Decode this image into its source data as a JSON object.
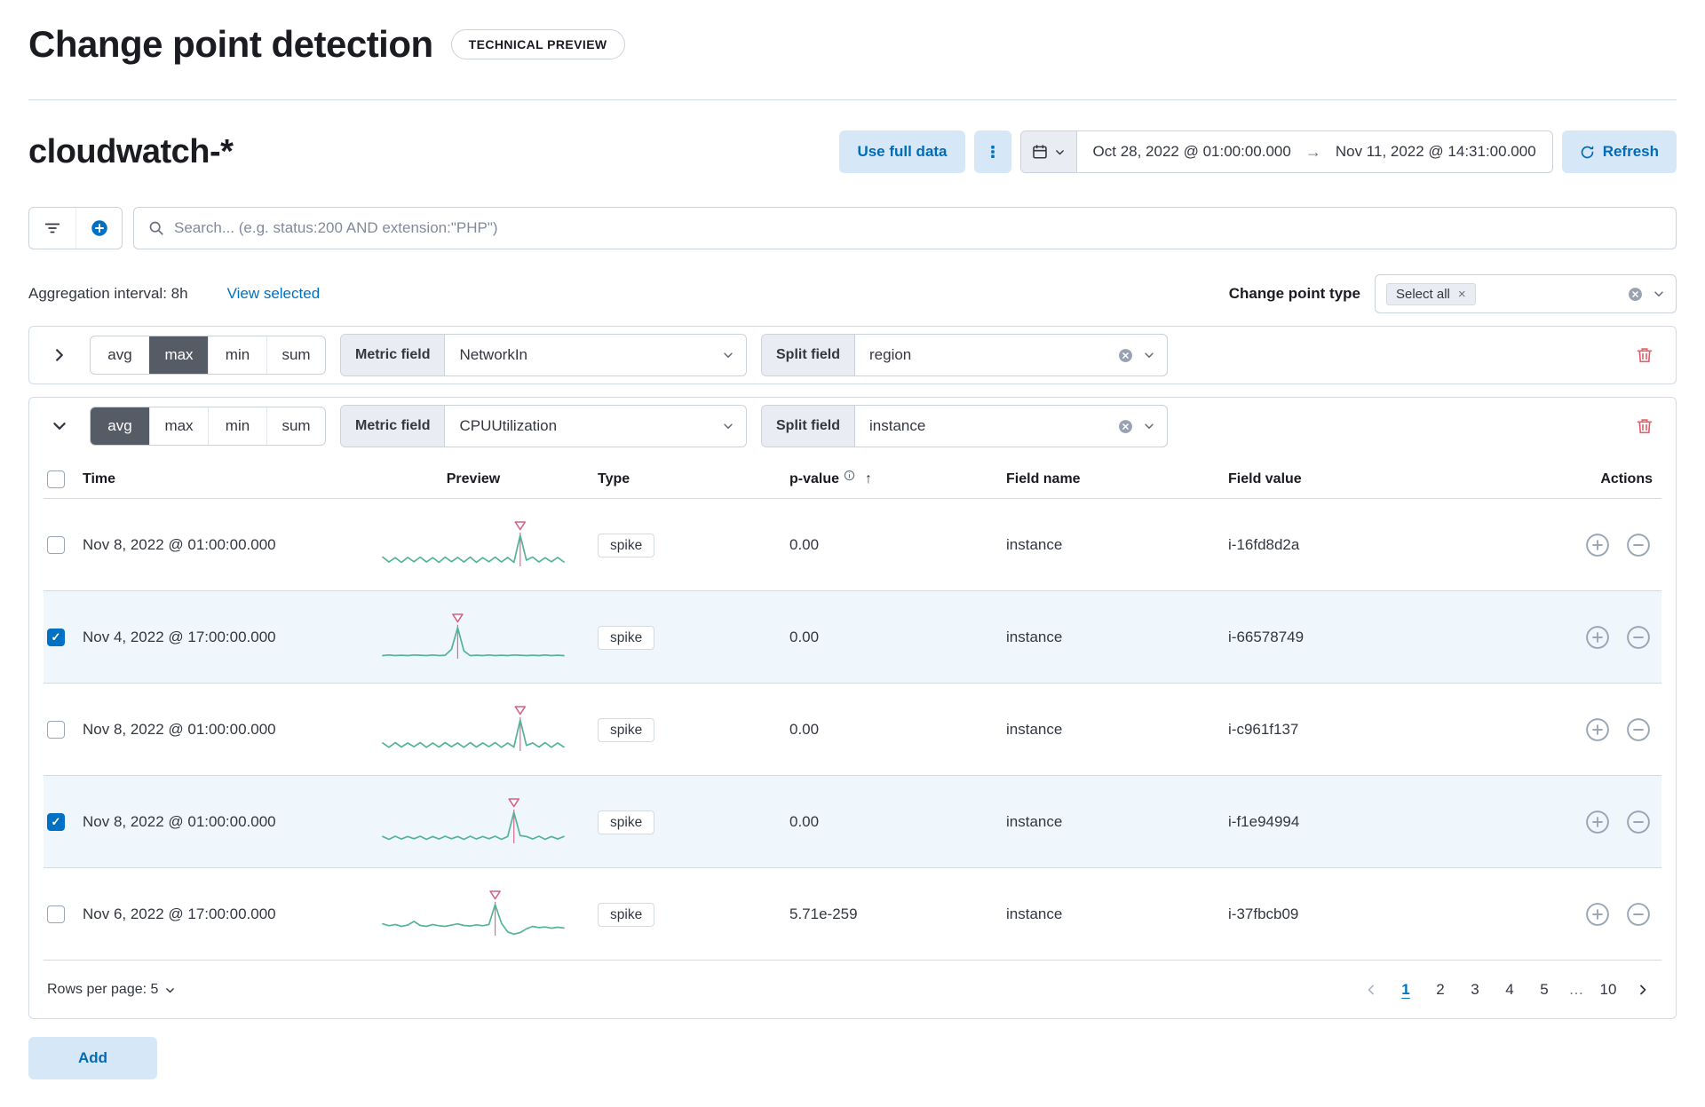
{
  "page": {
    "title": "Change point detection",
    "badge": "TECHNICAL PREVIEW"
  },
  "toolbar": {
    "data_view": "cloudwatch-*",
    "use_full_data_label": "Use full data",
    "date_start": "Oct 28, 2022 @ 01:00:00.000",
    "date_end": "Nov 11, 2022 @ 14:31:00.000",
    "refresh_label": "Refresh"
  },
  "search": {
    "placeholder": "Search... (e.g. status:200 AND extension:\"PHP\")"
  },
  "meta": {
    "aggregation_interval": "Aggregation interval: 8h",
    "view_selected_label": "View selected",
    "change_point_type_label": "Change point type",
    "change_point_type_selected": "Select all"
  },
  "configs": [
    {
      "expanded": false,
      "functions": [
        "avg",
        "max",
        "min",
        "sum"
      ],
      "selected_function": "max",
      "metric_field_label": "Metric field",
      "metric_field_value": "NetworkIn",
      "split_field_label": "Split field",
      "split_field_value": "region"
    },
    {
      "expanded": true,
      "functions": [
        "avg",
        "max",
        "min",
        "sum"
      ],
      "selected_function": "avg",
      "metric_field_label": "Metric field",
      "metric_field_value": "CPUUtilization",
      "split_field_label": "Split field",
      "split_field_value": "instance"
    }
  ],
  "table": {
    "columns": {
      "time": "Time",
      "preview": "Preview",
      "type": "Type",
      "p_value": "p-value",
      "field_name": "Field name",
      "field_value": "Field value",
      "actions": "Actions"
    },
    "rows": [
      {
        "checked": false,
        "time": "Nov 8, 2022 @ 01:00:00.000",
        "type": "spike",
        "p_value": "0.00",
        "field_name": "instance",
        "field_value": "i-16fd8d2a"
      },
      {
        "checked": true,
        "time": "Nov 4, 2022 @ 17:00:00.000",
        "type": "spike",
        "p_value": "0.00",
        "field_name": "instance",
        "field_value": "i-66578749"
      },
      {
        "checked": false,
        "time": "Nov 8, 2022 @ 01:00:00.000",
        "type": "spike",
        "p_value": "0.00",
        "field_name": "instance",
        "field_value": "i-c961f137"
      },
      {
        "checked": true,
        "time": "Nov 8, 2022 @ 01:00:00.000",
        "type": "spike",
        "p_value": "0.00",
        "field_name": "instance",
        "field_value": "i-f1e94994"
      },
      {
        "checked": false,
        "time": "Nov 6, 2022 @ 17:00:00.000",
        "type": "spike",
        "p_value": "5.71e-259",
        "field_name": "instance",
        "field_value": "i-37fbcb09"
      }
    ]
  },
  "pagination": {
    "rows_per_page_label": "Rows per page: 5",
    "pages": [
      "1",
      "2",
      "3",
      "4",
      "5",
      "…",
      "10"
    ],
    "active_page": "1"
  },
  "footer": {
    "add_label": "Add"
  },
  "colors": {
    "primary": "#0071c2",
    "line": "#54b399",
    "spike": "#d36086",
    "danger": "#e0616d"
  },
  "chart_data": {
    "type": "line",
    "description": "Row preview sparklines; green line = metric over time, pink vertical line + open triangle marker = detected change point (spike)",
    "sparklines": [
      {
        "field_value": "i-16fd8d2a",
        "spike_index": 22,
        "values": [
          0.3,
          0.14,
          0.28,
          0.13,
          0.29,
          0.15,
          0.3,
          0.14,
          0.28,
          0.13,
          0.3,
          0.15,
          0.29,
          0.14,
          0.3,
          0.13,
          0.28,
          0.15,
          0.3,
          0.14,
          0.29,
          0.13,
          1.0,
          0.2,
          0.3,
          0.14,
          0.28,
          0.15,
          0.29,
          0.14
        ]
      },
      {
        "field_value": "i-66578749",
        "spike_index": 12,
        "values": [
          0.1,
          0.12,
          0.1,
          0.11,
          0.1,
          0.12,
          0.11,
          0.1,
          0.12,
          0.1,
          0.11,
          0.3,
          1.0,
          0.25,
          0.1,
          0.11,
          0.1,
          0.12,
          0.1,
          0.11,
          0.1,
          0.12,
          0.11,
          0.1,
          0.11,
          0.1,
          0.12,
          0.1,
          0.11,
          0.1
        ]
      },
      {
        "field_value": "i-c961f137",
        "spike_index": 22,
        "values": [
          0.26,
          0.12,
          0.27,
          0.13,
          0.26,
          0.14,
          0.27,
          0.12,
          0.26,
          0.13,
          0.27,
          0.14,
          0.26,
          0.12,
          0.27,
          0.13,
          0.26,
          0.14,
          0.27,
          0.12,
          0.26,
          0.13,
          1.0,
          0.18,
          0.26,
          0.13,
          0.27,
          0.12,
          0.26,
          0.13
        ]
      },
      {
        "field_value": "i-f1e94994",
        "spike_index": 21,
        "values": [
          0.22,
          0.13,
          0.23,
          0.14,
          0.22,
          0.15,
          0.23,
          0.13,
          0.22,
          0.14,
          0.23,
          0.15,
          0.22,
          0.13,
          0.23,
          0.14,
          0.22,
          0.15,
          0.23,
          0.13,
          0.22,
          1.0,
          0.25,
          0.22,
          0.14,
          0.23,
          0.13,
          0.22,
          0.14,
          0.22
        ]
      },
      {
        "field_value": "i-37fbcb09",
        "spike_index": 18,
        "values": [
          0.38,
          0.32,
          0.36,
          0.3,
          0.34,
          0.46,
          0.33,
          0.3,
          0.36,
          0.32,
          0.3,
          0.34,
          0.38,
          0.33,
          0.31,
          0.35,
          0.32,
          0.36,
          1.0,
          0.4,
          0.12,
          0.05,
          0.1,
          0.22,
          0.3,
          0.26,
          0.28,
          0.24,
          0.27,
          0.25
        ]
      }
    ]
  }
}
